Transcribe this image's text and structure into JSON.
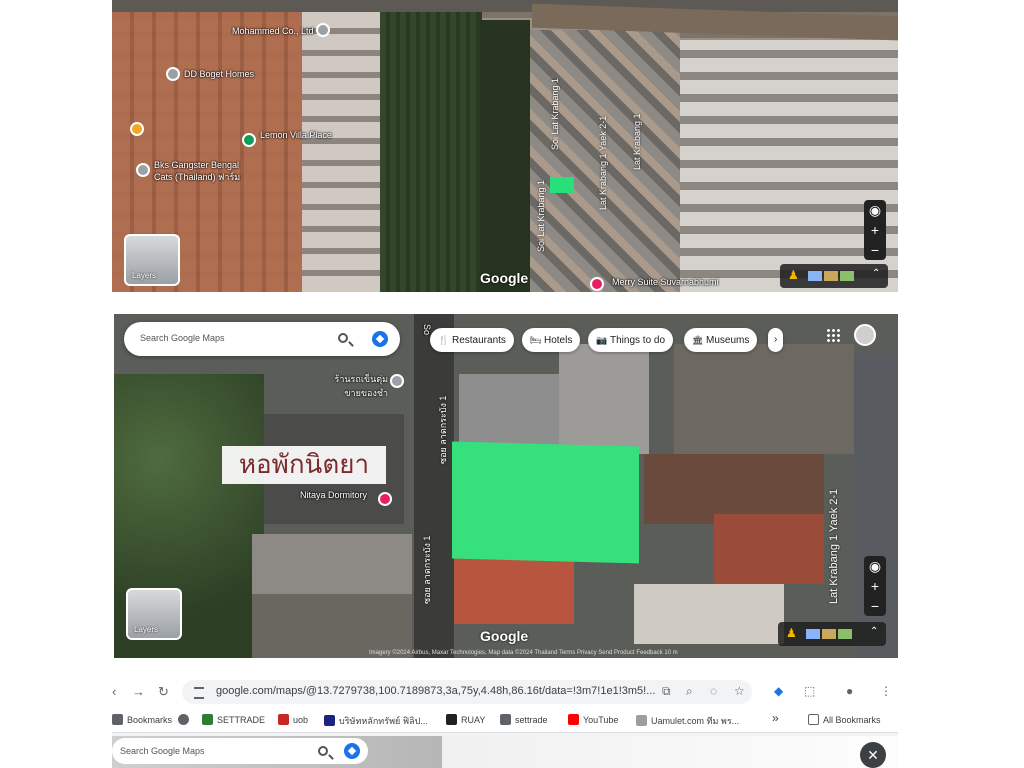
{
  "map1": {
    "labels": {
      "business1": "Mohammed Co., Ltd",
      "business2": "DD Boget Homes",
      "business3": "Lemon Villa Place",
      "business4": "Bks Gangster Bengal Cats (Thailand) ฟาร์ม",
      "street1": "Soi Lat Krabang 1",
      "street2": "Lat Krabang 1 Yaek 2-1",
      "street3": "Soi Lat Krabang 1",
      "street4": "Lat Krabang 1",
      "poi_bottom": "Merry Suite Suvarnabhumi"
    },
    "google": "Google",
    "layers": "Layers"
  },
  "map2": {
    "search_placeholder": "Search Google Maps",
    "chips": [
      {
        "icon": "🍴",
        "label": "Restaurants"
      },
      {
        "icon": "🛏",
        "label": "Hotels"
      },
      {
        "icon": "📷",
        "label": "Things to do"
      },
      {
        "icon": "🏛",
        "label": "Museums"
      }
    ],
    "chip_more": "›",
    "thai_title": "หอพักนิตยา",
    "labels": {
      "poi_top": "ร้านรถเข็นตุ่ม ขายของชำ",
      "poi_mid": "Nitaya Dormitory",
      "street_left": "ซอย ลาดกระบัง 1",
      "street_left2": "ซอย ลาดกระบัง 1",
      "street_right": "Lat Krabang 1 Yaek 2-1",
      "street_top": "So"
    },
    "google": "Google",
    "layers": "Layers",
    "attribution": "Imagery ©2024 Airbus, Maxar Technologies, Map data ©2024   Thailand   Terms   Privacy   Send Product Feedback   10 m"
  },
  "browser": {
    "url": "google.com/maps/@13.7279738,100.7189873,3a,75y,4.48h,86.16t/data=!3m7!1e1!3m5!...",
    "bookmarks": [
      {
        "label": "Bookmarks",
        "color": "#5f6368"
      },
      {
        "label": "",
        "color": "#5f6368"
      },
      {
        "label": "SETTRADE",
        "color": "#2e7d32"
      },
      {
        "label": "uob",
        "color": "#c62828"
      },
      {
        "label": "บริษัทหลักทรัพย์ ฟิลิป...",
        "color": "#1a237e"
      },
      {
        "label": "RUAY",
        "color": "#212121"
      },
      {
        "label": "settrade",
        "color": "#5f6368"
      },
      {
        "label": "YouTube",
        "color": "#ff0000"
      },
      {
        "label": "Uamulet.com ทีม พร...",
        "color": "#9e9e9e"
      }
    ],
    "more": "»",
    "all_bookmarks": "All Bookmarks",
    "bottom_search_placeholder": "Search Google Maps",
    "close": "✕"
  }
}
